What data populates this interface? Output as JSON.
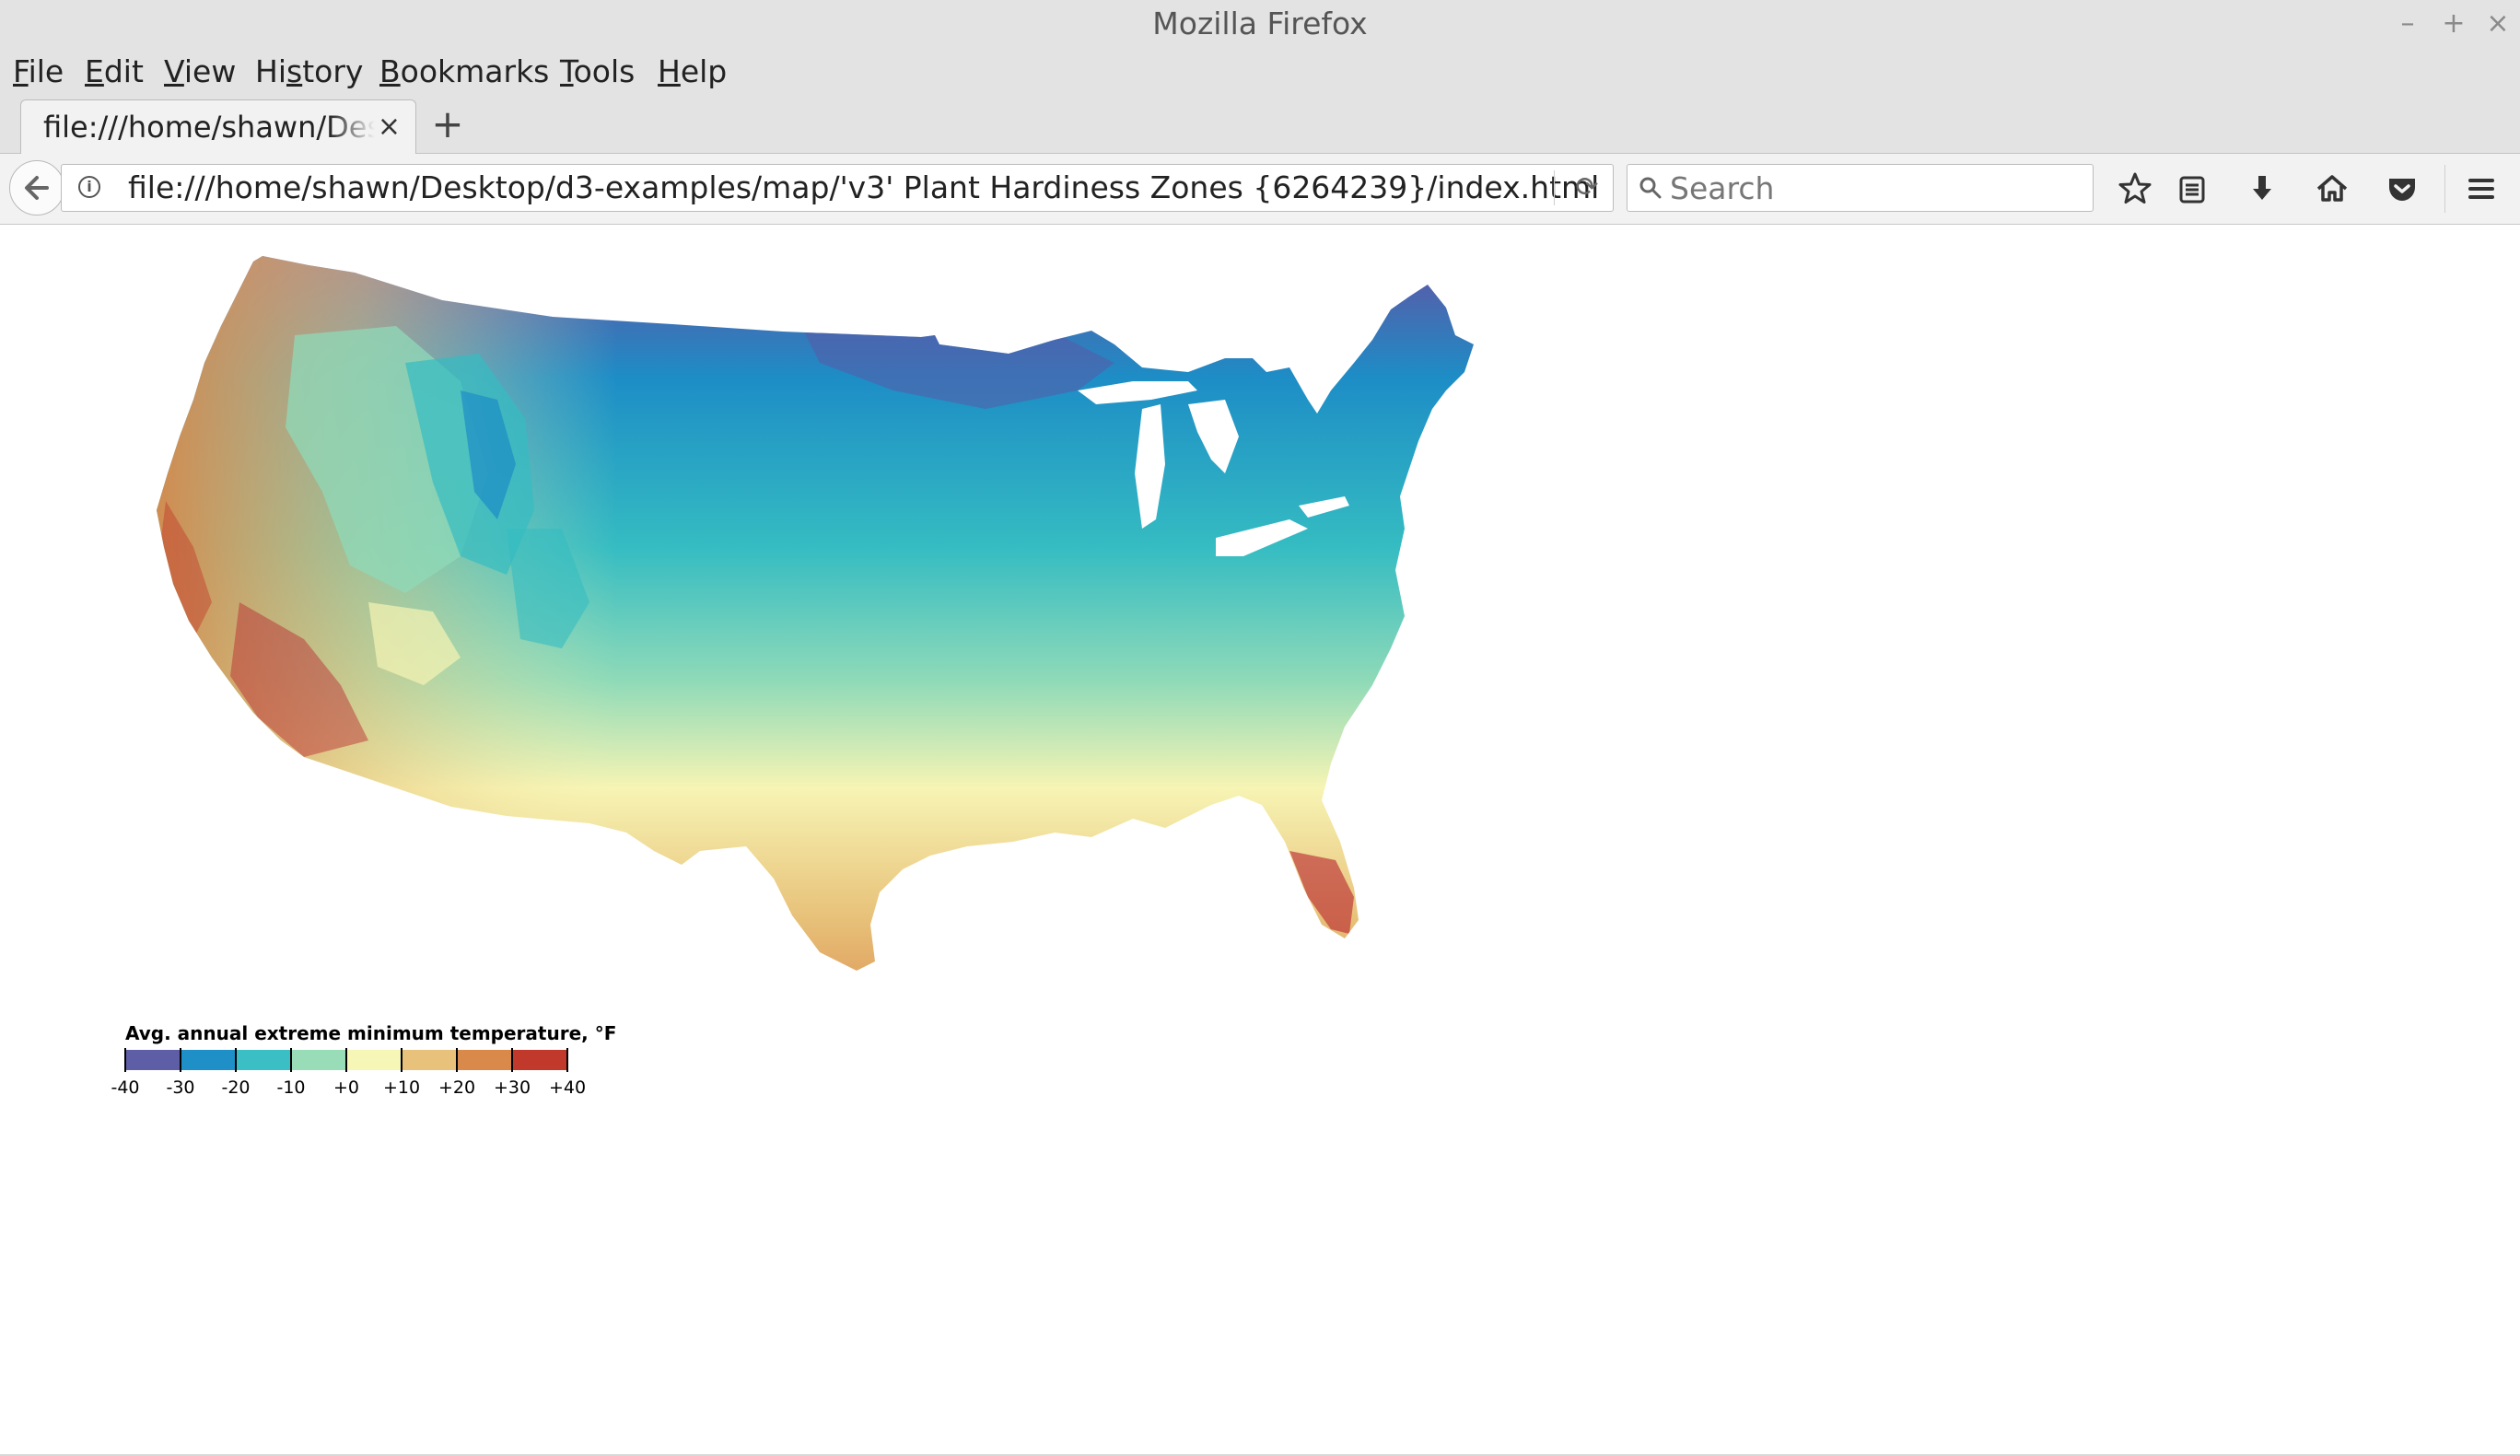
{
  "window": {
    "title": "Mozilla Firefox",
    "controls": [
      "–",
      "+",
      "×"
    ]
  },
  "menubar": {
    "items": [
      {
        "pre": "",
        "acc": "F",
        "post": "ile"
      },
      {
        "pre": "",
        "acc": "E",
        "post": "dit"
      },
      {
        "pre": "",
        "acc": "V",
        "post": "iew"
      },
      {
        "pre": "Hi",
        "acc": "s",
        "post": "tory"
      },
      {
        "pre": "",
        "acc": "B",
        "post": "ookmarks"
      },
      {
        "pre": "",
        "acc": "T",
        "post": "ools"
      },
      {
        "pre": "",
        "acc": "H",
        "post": "elp"
      }
    ]
  },
  "tabs": [
    {
      "title": "file:///home/shawn/Desktop/d3-examples/map/'v3' Plant Hardiness Zones {6264239}/index.html",
      "close": "×"
    }
  ],
  "newtab": {
    "label": "+"
  },
  "navbar": {
    "url": "file:///home/shawn/Desktop/d3-examples/map/'v3' Plant Hardiness Zones {6264239}/index.html",
    "search_placeholder": "Search",
    "search_value": ""
  },
  "icons": {
    "back": "back-arrow-icon",
    "info": "info-icon",
    "reload": "reload-icon",
    "search": "search-icon",
    "bookmark": "bookmark-star-icon",
    "reader": "reading-list-icon",
    "download": "download-icon",
    "home": "home-icon",
    "pocket": "pocket-icon",
    "menu": "hamburger-menu-icon"
  },
  "legend": {
    "title": "Avg. annual extreme minimum temperature, °F",
    "ticks": [
      "-40",
      "-30",
      "-20",
      "-10",
      "+0",
      "+10",
      "+20",
      "+30",
      "+40"
    ],
    "colors": [
      "#5e5ea6",
      "#1e8fc7",
      "#3bbfc4",
      "#99ddb8",
      "#f6f6b6",
      "#e8c27a",
      "#d98a4a",
      "#c0392b"
    ]
  },
  "map_colors": {
    "deep_cold": "#5a5aa8",
    "cold": "#1d8dc6",
    "cool": "#35bcc2",
    "mild": "#8fdab8",
    "neutral": "#f7f4b4",
    "warm": "#e8c37b",
    "hot": "#da8c4c",
    "hottest": "#b8232f"
  }
}
